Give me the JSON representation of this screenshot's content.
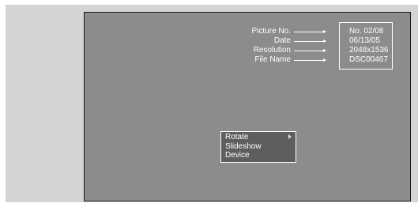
{
  "callouts": {
    "picture_no": "Picture No.",
    "date": "Date",
    "resolution": "Resolution",
    "file_name": "File Name"
  },
  "info": {
    "picture_no": "No. 02/08",
    "date": "06/13/05",
    "resolution": "2048x1536",
    "file_name": "DSC00467"
  },
  "menu": {
    "items": [
      "Rotate",
      "Slideshow",
      "Device"
    ],
    "submenu_icon": "play-triangle-icon"
  },
  "colors": {
    "background": "#d4d4d4",
    "screen": "#8c8c8c",
    "menu_fill": "#5e5e5e",
    "text": "#ffffff"
  }
}
